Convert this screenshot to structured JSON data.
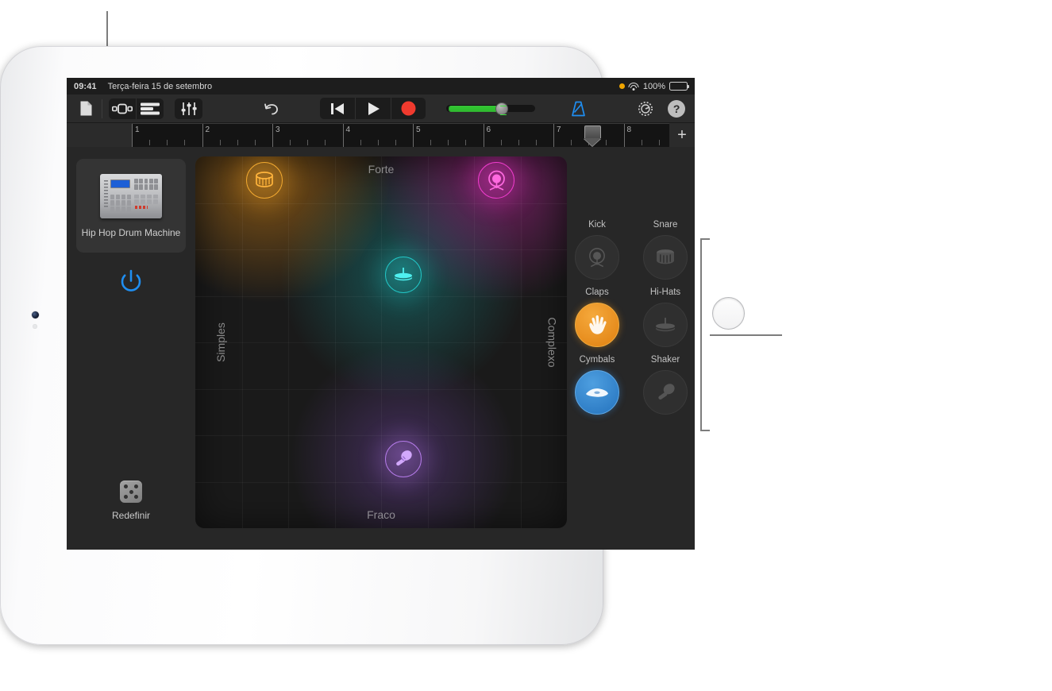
{
  "statusbar": {
    "time": "09:41",
    "date": "Terça-feira 15 de setembro",
    "battery_percent": "100%",
    "icons": [
      "orange-dot-icon",
      "wifi-icon",
      "battery-icon"
    ]
  },
  "toolbar": {
    "buttons": [
      {
        "name": "document-icon",
        "label": "Documentos"
      },
      {
        "name": "instrument-view-icon",
        "label": "Instrumento"
      },
      {
        "name": "tracks-view-icon",
        "label": "Faixas"
      },
      {
        "name": "mixer-icon",
        "label": "Controlos"
      },
      {
        "name": "undo-icon",
        "label": "Anular"
      },
      {
        "name": "rewind-icon",
        "label": "Início"
      },
      {
        "name": "play-icon",
        "label": "Reproduzir"
      },
      {
        "name": "record-icon",
        "label": "Gravar"
      },
      {
        "name": "metronome-icon",
        "label": "Metrónomo"
      },
      {
        "name": "gear-icon",
        "label": "Definições"
      },
      {
        "name": "help-icon",
        "label": "?"
      }
    ],
    "help_glyph": "?",
    "master_volume_percent": 58
  },
  "ruler": {
    "bars": [
      "1",
      "2",
      "3",
      "4",
      "5",
      "6",
      "7",
      "8"
    ],
    "playhead_bar": 7.55,
    "add_button": "+"
  },
  "instrument": {
    "name": "Hip Hop Drum Machine",
    "power_label": "power-button",
    "reset_label": "Redefinir"
  },
  "xy_pad": {
    "top_label": "Forte",
    "bottom_label": "Fraco",
    "left_label": "Simples",
    "right_label": "Complexo",
    "pucks": [
      {
        "name": "snare-puck",
        "color": "#f0a830",
        "x_pct": 18.5,
        "y_pct": 6.5,
        "icon": "snare-drum-icon"
      },
      {
        "name": "kick-puck",
        "color": "#f03ccd",
        "x_pct": 81.0,
        "y_pct": 6.5,
        "icon": "kick-drum-icon"
      },
      {
        "name": "hihat-puck",
        "color": "#22c6c6",
        "x_pct": 56.0,
        "y_pct": 31.8,
        "icon": "hi-hat-icon"
      },
      {
        "name": "shaker-puck",
        "color": "#b47ae8",
        "x_pct": 56.0,
        "y_pct": 81.5,
        "icon": "shaker-icon"
      }
    ]
  },
  "drum_parts": [
    {
      "label": "Kick",
      "state": "off",
      "icon": "kick-drum-icon"
    },
    {
      "label": "Snare",
      "state": "off",
      "icon": "snare-drum-icon"
    },
    {
      "label": "Claps",
      "state": "orange",
      "icon": "hand-clap-icon"
    },
    {
      "label": "Hi-Hats",
      "state": "off",
      "icon": "hi-hat-icon"
    },
    {
      "label": "Cymbals",
      "state": "blue",
      "icon": "cymbal-icon"
    },
    {
      "label": "Shaker",
      "state": "off",
      "icon": "shaker-icon"
    }
  ],
  "colors": {
    "accent_blue": "#1f8ef1",
    "record_red": "#f0302a",
    "active_orange": "#eb9a1e",
    "active_blue": "#3c8cdc",
    "callout_gray": "#7d7d7d"
  }
}
